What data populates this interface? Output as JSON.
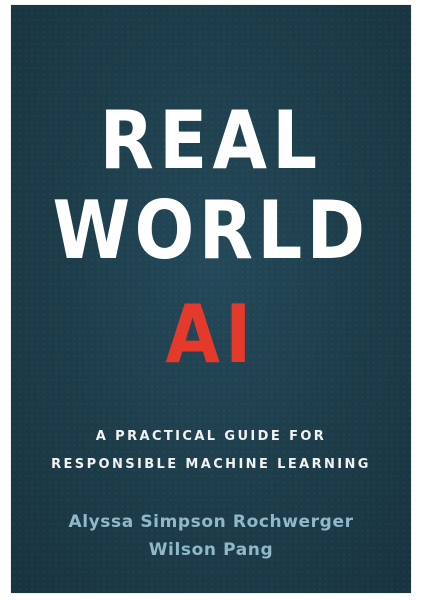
{
  "book": {
    "title_lines": [
      "REAL",
      "WORLD",
      "AI"
    ],
    "subtitle_lines": [
      "A PRACTICAL GUIDE FOR",
      "RESPONSIBLE MACHINE LEARNING"
    ],
    "authors": [
      "Alyssa Simpson Rochwerger",
      "Wilson Pang"
    ]
  },
  "colors": {
    "background": "#1f3f4d",
    "title": "#ffffff",
    "title_accent": "#e5392b",
    "subtitle": "#f2f2f2",
    "authors": "#8fb8c9"
  }
}
